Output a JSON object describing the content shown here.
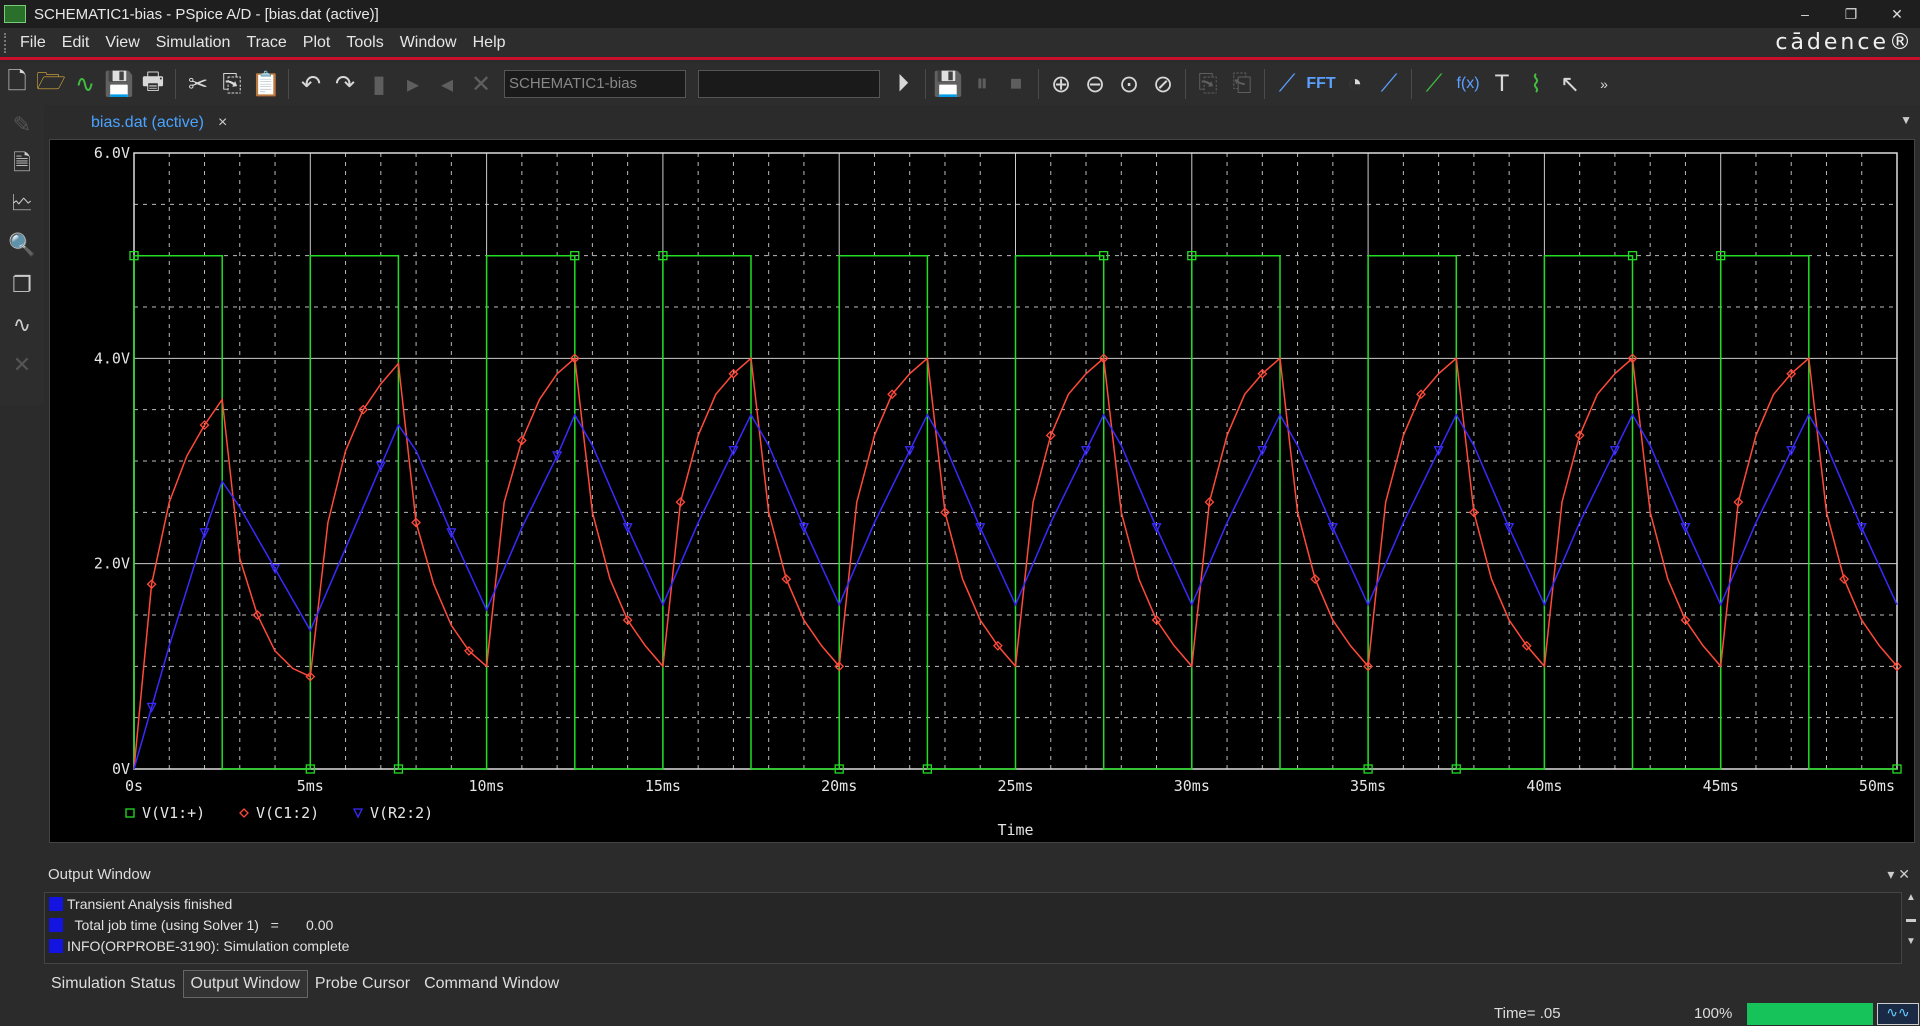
{
  "window": {
    "title": "SCHEMATIC1-bias - PSpice A/D  - [bias.dat (active)]",
    "minimize": "–",
    "restore": "❐",
    "close": "✕"
  },
  "menu": {
    "items": [
      "File",
      "Edit",
      "View",
      "Simulation",
      "Trace",
      "Plot",
      "Tools",
      "Window",
      "Help"
    ],
    "brand": "cādence®"
  },
  "toolbar": {
    "profile_field": "SCHEMATIC1-bias",
    "fft_label": "FFT",
    "fx_label": "f(x)"
  },
  "tab": {
    "label": "bias.dat (active)",
    "close": "×"
  },
  "output_window": {
    "title": "Output Window",
    "lines": [
      "Transient Analysis finished",
      "  Total job time (using Solver 1)   =       0.00",
      "INFO(ORPROBE-3190): Simulation complete"
    ],
    "line_color": "#1414e0"
  },
  "bottom_tabs": [
    "Simulation Status",
    "Output Window",
    "Probe Cursor",
    "Command Window"
  ],
  "status": {
    "time": "Time= .05",
    "zoom": "100%",
    "progress": 1.0
  },
  "chart_data": {
    "type": "line",
    "xlabel": "Time",
    "ylabel": "",
    "xlim": [
      0,
      50
    ],
    "ylim": [
      0,
      6
    ],
    "x_ticks": [
      "0s",
      "5ms",
      "10ms",
      "15ms",
      "20ms",
      "25ms",
      "30ms",
      "35ms",
      "40ms",
      "45ms",
      "50ms"
    ],
    "y_ticks": [
      "0V",
      "2.0V",
      "4.0V",
      "6.0V"
    ],
    "grid": true,
    "legend_placement": "bottom-left",
    "series": [
      {
        "name": "V(V1:+)",
        "color": "#22dd22",
        "marker": "square",
        "points": [
          [
            0,
            0
          ],
          [
            0,
            5
          ],
          [
            2.5,
            5
          ],
          [
            2.5,
            0
          ],
          [
            5,
            0
          ],
          [
            5,
            5
          ],
          [
            7.5,
            5
          ],
          [
            7.5,
            0
          ],
          [
            10,
            0
          ],
          [
            10,
            5
          ],
          [
            12.5,
            5
          ],
          [
            12.5,
            0
          ],
          [
            15,
            0
          ],
          [
            15,
            5
          ],
          [
            17.5,
            5
          ],
          [
            17.5,
            0
          ],
          [
            20,
            0
          ],
          [
            20,
            5
          ],
          [
            22.5,
            5
          ],
          [
            22.5,
            0
          ],
          [
            25,
            0
          ],
          [
            25,
            5
          ],
          [
            27.5,
            5
          ],
          [
            27.5,
            0
          ],
          [
            30,
            0
          ],
          [
            30,
            5
          ],
          [
            32.5,
            5
          ],
          [
            32.5,
            0
          ],
          [
            35,
            0
          ],
          [
            35,
            5
          ],
          [
            37.5,
            5
          ],
          [
            37.5,
            0
          ],
          [
            40,
            0
          ],
          [
            40,
            5
          ],
          [
            42.5,
            5
          ],
          [
            42.5,
            0
          ],
          [
            45,
            0
          ],
          [
            45,
            5
          ],
          [
            47.5,
            5
          ],
          [
            47.5,
            0
          ],
          [
            50,
            0
          ]
        ]
      },
      {
        "name": "V(C1:2)",
        "color": "#ff4a3a",
        "marker": "diamond",
        "points": [
          [
            0,
            0
          ],
          [
            0.5,
            1.8
          ],
          [
            1.0,
            2.6
          ],
          [
            1.5,
            3.05
          ],
          [
            2.0,
            3.35
          ],
          [
            2.5,
            3.6
          ],
          [
            3.0,
            2.05
          ],
          [
            3.5,
            1.5
          ],
          [
            4.0,
            1.15
          ],
          [
            4.5,
            0.98
          ],
          [
            5.0,
            0.9
          ],
          [
            5.5,
            2.4
          ],
          [
            6.0,
            3.1
          ],
          [
            6.5,
            3.5
          ],
          [
            7.0,
            3.75
          ],
          [
            7.5,
            3.95
          ],
          [
            8.0,
            2.4
          ],
          [
            8.5,
            1.8
          ],
          [
            9.0,
            1.4
          ],
          [
            9.5,
            1.15
          ],
          [
            10.0,
            1.0
          ],
          [
            10.5,
            2.6
          ],
          [
            11.0,
            3.2
          ],
          [
            11.5,
            3.6
          ],
          [
            12.0,
            3.85
          ],
          [
            12.5,
            4.0
          ],
          [
            13.0,
            2.5
          ],
          [
            13.5,
            1.85
          ],
          [
            14.0,
            1.45
          ],
          [
            14.5,
            1.2
          ],
          [
            15.0,
            1.0
          ],
          [
            15.5,
            2.6
          ],
          [
            16.0,
            3.25
          ],
          [
            16.5,
            3.65
          ],
          [
            17.0,
            3.85
          ],
          [
            17.5,
            4.0
          ],
          [
            18.0,
            2.5
          ],
          [
            18.5,
            1.85
          ],
          [
            19.0,
            1.45
          ],
          [
            19.5,
            1.2
          ],
          [
            20.0,
            1.0
          ],
          [
            20.5,
            2.6
          ],
          [
            21.0,
            3.25
          ],
          [
            21.5,
            3.65
          ],
          [
            22.0,
            3.85
          ],
          [
            22.5,
            4.0
          ],
          [
            23.0,
            2.5
          ],
          [
            23.5,
            1.85
          ],
          [
            24.0,
            1.45
          ],
          [
            24.5,
            1.2
          ],
          [
            25.0,
            1.0
          ],
          [
            25.5,
            2.6
          ],
          [
            26.0,
            3.25
          ],
          [
            26.5,
            3.65
          ],
          [
            27.0,
            3.85
          ],
          [
            27.5,
            4.0
          ],
          [
            28.0,
            2.5
          ],
          [
            28.5,
            1.85
          ],
          [
            29.0,
            1.45
          ],
          [
            29.5,
            1.2
          ],
          [
            30.0,
            1.0
          ],
          [
            30.5,
            2.6
          ],
          [
            31.0,
            3.25
          ],
          [
            31.5,
            3.65
          ],
          [
            32.0,
            3.85
          ],
          [
            32.5,
            4.0
          ],
          [
            33.0,
            2.5
          ],
          [
            33.5,
            1.85
          ],
          [
            34.0,
            1.45
          ],
          [
            34.5,
            1.2
          ],
          [
            35.0,
            1.0
          ],
          [
            35.5,
            2.6
          ],
          [
            36.0,
            3.25
          ],
          [
            36.5,
            3.65
          ],
          [
            37.0,
            3.85
          ],
          [
            37.5,
            4.0
          ],
          [
            38.0,
            2.5
          ],
          [
            38.5,
            1.85
          ],
          [
            39.0,
            1.45
          ],
          [
            39.5,
            1.2
          ],
          [
            40.0,
            1.0
          ],
          [
            40.5,
            2.6
          ],
          [
            41.0,
            3.25
          ],
          [
            41.5,
            3.65
          ],
          [
            42.0,
            3.85
          ],
          [
            42.5,
            4.0
          ],
          [
            43.0,
            2.5
          ],
          [
            43.5,
            1.85
          ],
          [
            44.0,
            1.45
          ],
          [
            44.5,
            1.2
          ],
          [
            45.0,
            1.0
          ],
          [
            45.5,
            2.6
          ],
          [
            46.0,
            3.25
          ],
          [
            46.5,
            3.65
          ],
          [
            47.0,
            3.85
          ],
          [
            47.5,
            4.0
          ],
          [
            48.0,
            2.5
          ],
          [
            48.5,
            1.85
          ],
          [
            49.0,
            1.45
          ],
          [
            49.5,
            1.2
          ],
          [
            50.0,
            1.0
          ]
        ]
      },
      {
        "name": "V(R2:2)",
        "color": "#3a2aff",
        "marker": "triangle",
        "points": [
          [
            0,
            0
          ],
          [
            0.5,
            0.6
          ],
          [
            1.0,
            1.2
          ],
          [
            1.5,
            1.75
          ],
          [
            2.0,
            2.3
          ],
          [
            2.5,
            2.8
          ],
          [
            3.0,
            2.55
          ],
          [
            4.0,
            1.95
          ],
          [
            5.0,
            1.35
          ],
          [
            6.0,
            2.15
          ],
          [
            7.0,
            2.95
          ],
          [
            7.5,
            3.35
          ],
          [
            8.0,
            3.1
          ],
          [
            9.0,
            2.3
          ],
          [
            10.0,
            1.55
          ],
          [
            11.0,
            2.35
          ],
          [
            12.0,
            3.05
          ],
          [
            12.5,
            3.45
          ],
          [
            13.0,
            3.15
          ],
          [
            14.0,
            2.35
          ],
          [
            15.0,
            1.6
          ],
          [
            16.0,
            2.4
          ],
          [
            17.0,
            3.1
          ],
          [
            17.5,
            3.45
          ],
          [
            18.0,
            3.15
          ],
          [
            19.0,
            2.35
          ],
          [
            20.0,
            1.6
          ],
          [
            21.0,
            2.4
          ],
          [
            22.0,
            3.1
          ],
          [
            22.5,
            3.45
          ],
          [
            23.0,
            3.15
          ],
          [
            24.0,
            2.35
          ],
          [
            25.0,
            1.6
          ],
          [
            26.0,
            2.4
          ],
          [
            27.0,
            3.1
          ],
          [
            27.5,
            3.45
          ],
          [
            28.0,
            3.15
          ],
          [
            29.0,
            2.35
          ],
          [
            30.0,
            1.6
          ],
          [
            31.0,
            2.4
          ],
          [
            32.0,
            3.1
          ],
          [
            32.5,
            3.45
          ],
          [
            33.0,
            3.15
          ],
          [
            34.0,
            2.35
          ],
          [
            35.0,
            1.6
          ],
          [
            36.0,
            2.4
          ],
          [
            37.0,
            3.1
          ],
          [
            37.5,
            3.45
          ],
          [
            38.0,
            3.15
          ],
          [
            39.0,
            2.35
          ],
          [
            40.0,
            1.6
          ],
          [
            41.0,
            2.4
          ],
          [
            42.0,
            3.1
          ],
          [
            42.5,
            3.45
          ],
          [
            43.0,
            3.15
          ],
          [
            44.0,
            2.35
          ],
          [
            45.0,
            1.6
          ],
          [
            46.0,
            2.4
          ],
          [
            47.0,
            3.1
          ],
          [
            47.5,
            3.45
          ],
          [
            48.0,
            3.15
          ],
          [
            49.0,
            2.35
          ],
          [
            50.0,
            1.6
          ]
        ]
      }
    ]
  }
}
